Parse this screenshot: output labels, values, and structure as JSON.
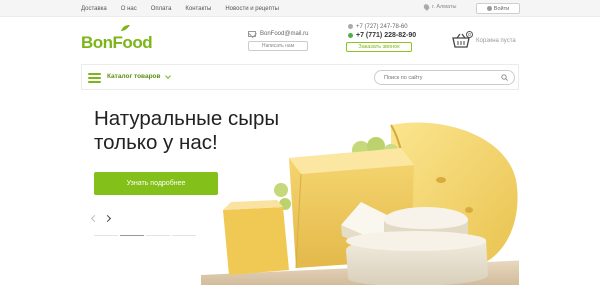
{
  "topnav": {
    "items": [
      "Доставка",
      "О нас",
      "Оплата",
      "Контакты",
      "Новости и рецепты"
    ],
    "city": "г. Алматы",
    "login_label": "Войти"
  },
  "header": {
    "logo": "BonFood",
    "email": "BonFood@mail.ru",
    "write_label": "Написать нам",
    "phone1": "+7 (727) 247-78-60",
    "phone2": "+7 (771) 228-82-90",
    "call_label": "Заказать звонок",
    "cart_count": "0",
    "cart_label": "Корзина пуста"
  },
  "catalog": {
    "label": "Каталог товаров",
    "search_placeholder": "Поиск по сайту"
  },
  "hero": {
    "title_line1": "Натуральные сыры",
    "title_line2": "только у нас!",
    "button_label": "Узнать подробнее"
  },
  "colors": {
    "brand_green": "#84c01a",
    "text_dark": "#222222"
  }
}
